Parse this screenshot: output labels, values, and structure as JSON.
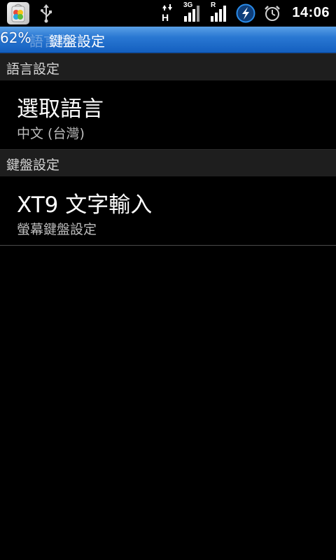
{
  "status_bar": {
    "network_type": "H",
    "signal1_label": "3G",
    "signal2_label": "R",
    "time": "14:06",
    "battery_percent": "62%"
  },
  "title_bar": {
    "hidden_prefix": "語言與",
    "title": "鍵盤設定"
  },
  "sections": [
    {
      "header": "語言設定",
      "item": {
        "title": "選取語言",
        "summary": "中文 (台灣)"
      }
    },
    {
      "header": "鍵盤設定",
      "item": {
        "title": "XT9 文字輸入",
        "summary": "螢幕鍵盤設定"
      }
    }
  ],
  "colors": {
    "title_bar": "#2a78d3",
    "section_header": "#1e1e1e",
    "background": "#000000",
    "sync_accent": "#2a8be8"
  }
}
